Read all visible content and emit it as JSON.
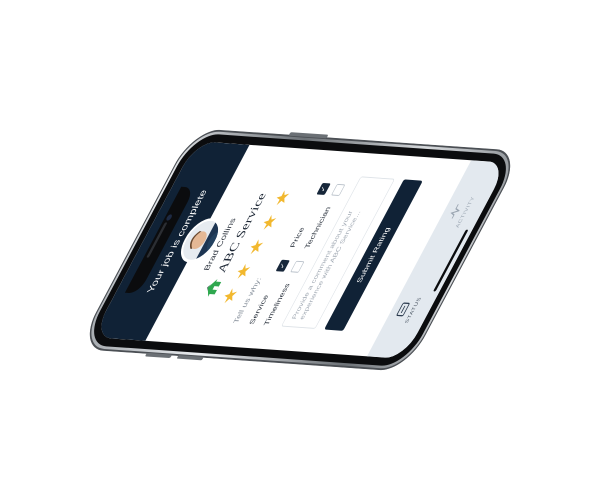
{
  "header": {
    "title": "Your job is complete"
  },
  "technician": {
    "name": "Brad Collins"
  },
  "company": {
    "name": "ABC Service",
    "logo_icon": "house-icon"
  },
  "rating": {
    "stars": 5,
    "max": 5
  },
  "feedback": {
    "prompt": "Tell us why:",
    "options": [
      {
        "label": "Service",
        "checked": true
      },
      {
        "label": "Price",
        "checked": true
      },
      {
        "label": "Timeliness",
        "checked": false
      },
      {
        "label": "Technician",
        "checked": false
      }
    ],
    "comment_placeholder": "Provide a comment about your experience with ABC Service..."
  },
  "submit": {
    "label": "Submit Rating"
  },
  "tabs": [
    {
      "label": "STATUS",
      "icon": "status-icon",
      "active": true
    },
    {
      "label": "ACTIVITY",
      "icon": "activity-icon",
      "active": false
    }
  ],
  "colors": {
    "primary": "#102236",
    "accent": "#2fa84f",
    "star": "#f2b82e",
    "tabbar": "#e3e9ef"
  }
}
